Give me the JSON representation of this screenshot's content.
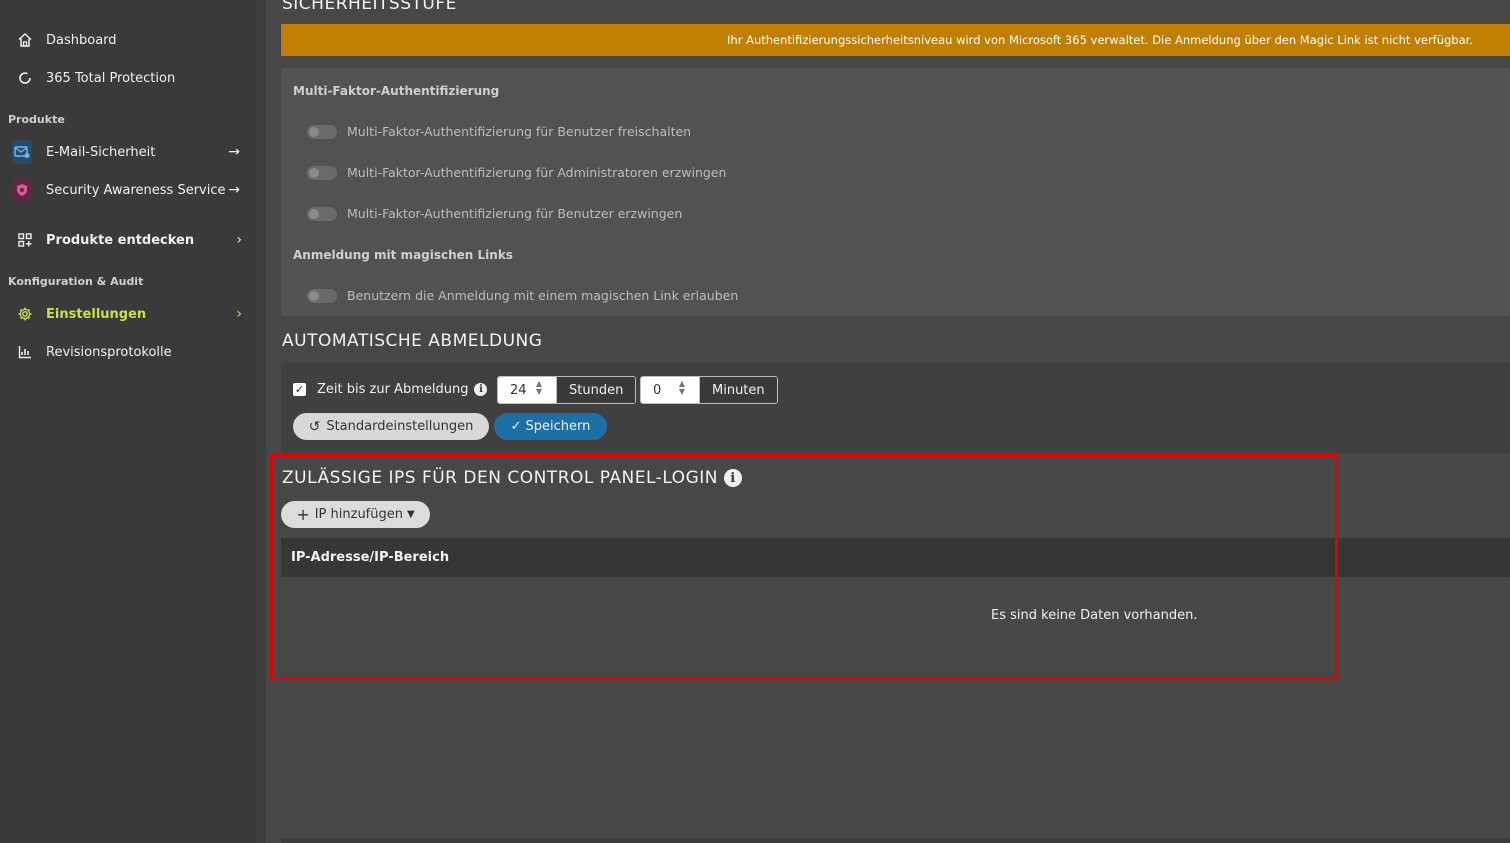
{
  "sidebar": {
    "nav_top": [
      {
        "label": "Dashboard",
        "icon": "home-icon"
      },
      {
        "label": "365 Total Protection",
        "icon": "circle-icon"
      }
    ],
    "section_products": "Produkte",
    "products": [
      {
        "label": "E-Mail-Sicherheit",
        "icon": "mail-shield-icon",
        "color": "#3a79b5"
      },
      {
        "label": "Security Awareness Service",
        "icon": "awareness-shield-icon",
        "color": "#c2347a"
      }
    ],
    "discover": {
      "label": "Produkte entdecken",
      "icon": "grid-plus-icon"
    },
    "section_config": "Konfiguration & Audit",
    "config": [
      {
        "label": "Einstellungen",
        "icon": "gear-icon",
        "active": true,
        "color": "#c7e04a"
      },
      {
        "label": "Revisionsprotokolle",
        "icon": "chart-icon"
      }
    ]
  },
  "security_level": {
    "heading": "SICHERHEITSSTUFE",
    "banner": "Ihr Authentifizierungssicherheitsniveau wird von Microsoft 365 verwaltet. Die Anmeldung über den Magic Link ist nicht verfügbar.",
    "banner_color": "#c07f00",
    "mfa_title": "Multi-Faktor-Authentifizierung",
    "mfa_options": [
      "Multi-Faktor-Authentifizierung für Benutzer freischalten",
      "Multi-Faktor-Authentifizierung für Administratoren erzwingen",
      "Multi-Faktor-Authentifizierung für Benutzer erzwingen"
    ],
    "magic_title": "Anmeldung mit magischen Links",
    "magic_option": "Benutzern die Anmeldung mit einem magischen Link erlauben"
  },
  "auto_logout": {
    "heading": "AUTOMATISCHE ABMELDUNG",
    "checkbox_label": "Zeit bis zur Abmeldung",
    "hours_value": "24",
    "hours_unit": "Stunden",
    "minutes_value": "0",
    "minutes_unit": "Minuten",
    "default_button": "Standardeinstellungen",
    "save_button": "Speichern"
  },
  "allowed_ips": {
    "heading": "ZULÄSSIGE IPS FÜR DEN CONTROL PANEL-LOGIN",
    "add_button": "IP hinzufügen",
    "column": "IP-Adresse/IP-Bereich",
    "empty_text": "Es sind keine Daten vorhanden."
  }
}
